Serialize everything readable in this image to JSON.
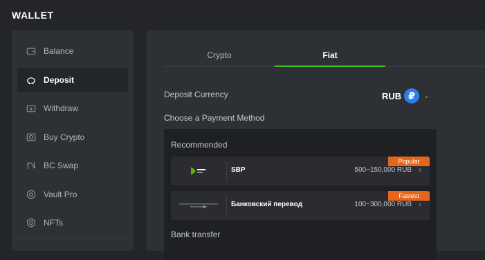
{
  "header": {
    "title": "WALLET"
  },
  "sidebar": {
    "items": [
      {
        "label": "Balance",
        "icon": "wallet-icon"
      },
      {
        "label": "Deposit",
        "icon": "piggy-bank-icon",
        "active": true
      },
      {
        "label": "Withdraw",
        "icon": "withdraw-icon"
      },
      {
        "label": "Buy Crypto",
        "icon": "buy-crypto-icon"
      },
      {
        "label": "BC Swap",
        "icon": "swap-icon"
      },
      {
        "label": "Vault Pro",
        "icon": "vault-icon"
      },
      {
        "label": "NFTs",
        "icon": "nft-icon"
      }
    ]
  },
  "tabs": [
    {
      "label": "Crypto",
      "active": false
    },
    {
      "label": "Fiat",
      "active": true
    }
  ],
  "deposit": {
    "currency_label": "Deposit Currency",
    "currency_value": "RUB",
    "currency_symbol": "₽",
    "payment_label": "Choose a Payment Method",
    "recommended_label": "Recommended",
    "bank_transfer_label": "Bank transfer",
    "methods": [
      {
        "name": "SBP",
        "range": "500~150,000 RUB",
        "badge": "Popular"
      },
      {
        "name": "Банковский перевод",
        "range": "100~300,000 RUB",
        "badge": "Fastest"
      }
    ]
  },
  "colors": {
    "accent": "#3bc117",
    "badge": "#e5661a",
    "rub_coin": "#2f7ee8"
  }
}
